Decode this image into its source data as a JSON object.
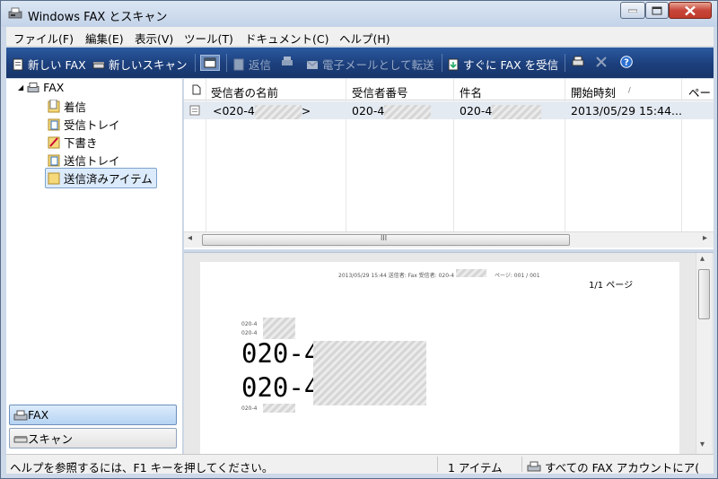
{
  "window": {
    "title": "Windows FAX とスキャン"
  },
  "menu": [
    "ファイル(F)",
    "編集(E)",
    "表示(V)",
    "ツール(T)",
    "ドキュメント(C)",
    "ヘルプ(H)"
  ],
  "toolbar": {
    "new_fax": "新しい FAX",
    "new_scan": "新しいスキャン",
    "reply": "返信",
    "forward_email": "電子メールとして転送",
    "receive_now": "すぐに FAX を受信"
  },
  "tree": {
    "root": "FAX",
    "items": [
      "着信",
      "受信トレイ",
      "下書き",
      "送信トレイ",
      "送信済みアイテム"
    ],
    "selected": "送信済みアイテム"
  },
  "sidebar_buttons": {
    "fax": "FAX",
    "scan": "スキャン"
  },
  "list": {
    "columns": [
      "受信者の名前",
      "受信者番号",
      "件名",
      "開始時刻",
      "ペー"
    ],
    "sort_indicator": "/",
    "rows": [
      {
        "name": "<020-4",
        "name_suffix": ">",
        "number": "020-4",
        "subject": "020-4",
        "start": "2013/05/29 15:44..."
      }
    ],
    "scroll_left": "◂",
    "scroll_right": "▸",
    "thumb_grip": "III"
  },
  "preview": {
    "header_line": "2013/05/29 15:44  送信者: Fax  受信者: 020-4",
    "header_page": "ページ: 001 / 001",
    "page_label": "1/1 ページ",
    "small1": "020-4",
    "small2": "020-4",
    "big1": "020-4",
    "big2": "020-4",
    "small3": "020-4",
    "scroll_up": "▴",
    "scroll_down": "▾"
  },
  "status": {
    "help": "ヘルプを参照するには、F1 キーを押してください。",
    "count": "1 アイテム",
    "account": "すべての FAX アカウントにア("
  },
  "colors": {
    "toolbar": "#1c3f7c",
    "selection": "#dcebfc"
  }
}
